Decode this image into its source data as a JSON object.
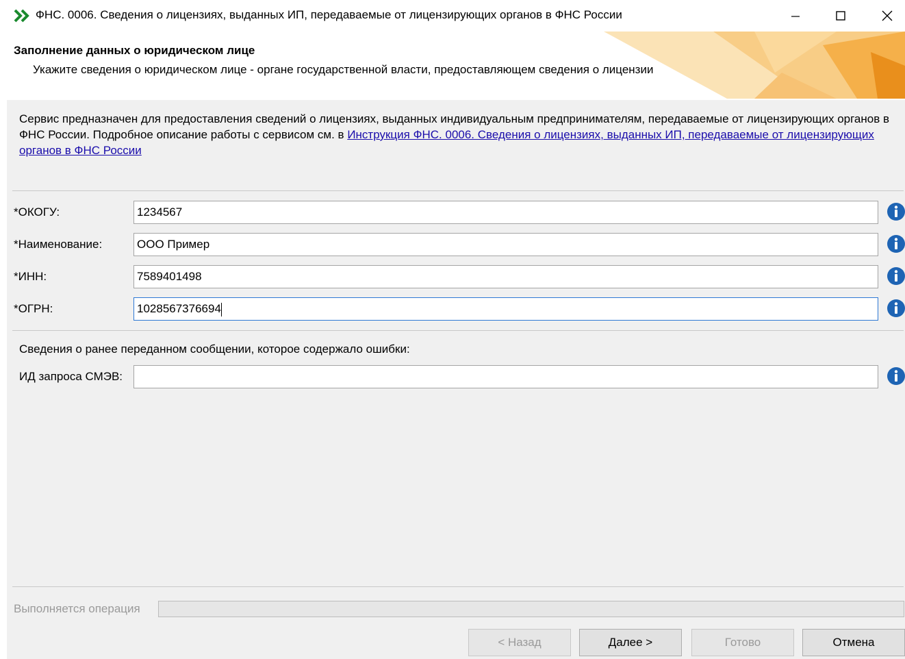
{
  "window": {
    "title": "ФНС. 0006. Сведения о лицензиях, выданных ИП, передаваемые от лицензирующих органов в ФНС России",
    "icon": "double-chevron-icon"
  },
  "header": {
    "title": "Заполнение данных о юридическом лице",
    "subtitle": "Укажите сведения о юридическом лице - органе государственной власти, предоставляющем сведения о лицензии"
  },
  "intro": {
    "text": "Сервис предназначен для предоставления сведений о лицензиях, выданных индивидуальным предпринимателям, передаваемые от лицензирующих органов в ФНС России. Подробное описание работы с сервисом см. в ",
    "link": "Инструкция ФНС. 0006. Сведения о лицензиях, выданных ИП, передаваемые от лицензирующих органов в ФНС России"
  },
  "form": {
    "okogu": {
      "label": "*ОКОГУ:",
      "value": "1234567"
    },
    "name": {
      "label": "*Наименование:",
      "value": "ООО Пример"
    },
    "inn": {
      "label": "*ИНН:",
      "value": "7589401498"
    },
    "ogrn": {
      "label": "*ОГРН:",
      "value": "1028567376694"
    }
  },
  "previous": {
    "heading": "Сведения о ранее переданном сообщении, которое содержало ошибки:",
    "smev": {
      "label": "ИД запроса СМЭВ:",
      "value": ""
    }
  },
  "progress": {
    "label": "Выполняется операция",
    "fraction": 0
  },
  "buttons": {
    "back": "< Назад",
    "next": "Далее >",
    "done": "Готово",
    "cancel": "Отмена"
  },
  "colors": {
    "accent_orange": "#f5a623",
    "info_blue": "#1e64b4",
    "link": "#1a0dab"
  }
}
